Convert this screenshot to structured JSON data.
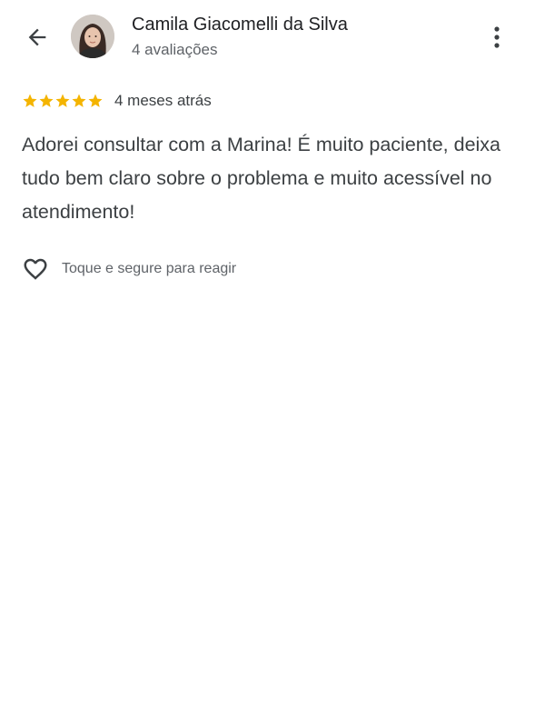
{
  "header": {
    "back_icon": "arrow-back-icon",
    "reviewer_name": "Camila Giacomelli da Silva",
    "review_count": "4 avaliações",
    "menu_icon": "more-vert-icon"
  },
  "review": {
    "rating": 5,
    "max_rating": 5,
    "star_color": "#F4B400",
    "time_ago": "4 meses atrás",
    "text": "Adorei consultar com a Marina! É muito paciente, deixa tudo bem claro sobre o problema e muito acessível no atendimento!"
  },
  "reaction": {
    "icon": "heart-outline-icon",
    "label": "Toque e segure para reagir"
  }
}
